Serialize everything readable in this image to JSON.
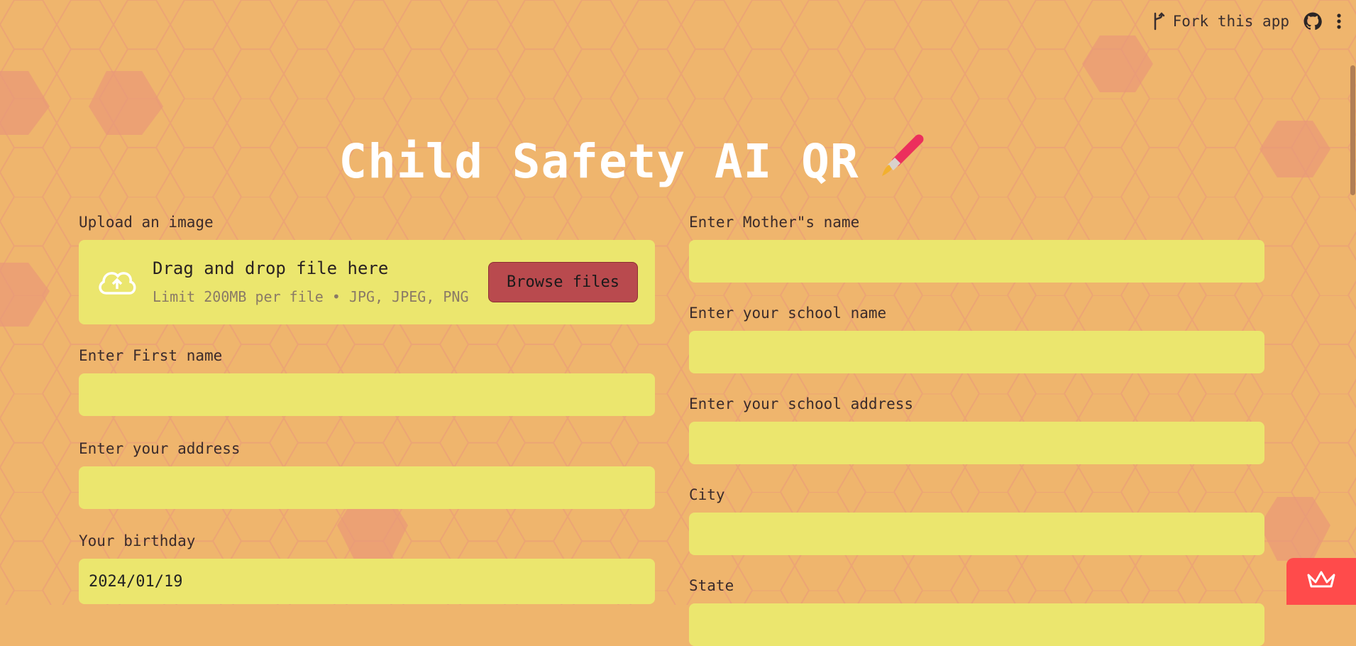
{
  "header": {
    "fork_label": "Fork this app",
    "fork_icon": "fork-icon",
    "github_icon": "github-icon",
    "menu_icon": "kebab-menu-icon"
  },
  "title": "Child Safety AI QR",
  "title_icon": "paintbrush-icon",
  "upload": {
    "label": "Upload an image",
    "drop_text": "Drag and drop file here",
    "limit_text": "Limit 200MB per file • JPG, JPEG, PNG",
    "button_label": "Browse files",
    "icon": "cloud-upload-icon"
  },
  "left_fields": {
    "first_name": {
      "label": "Enter First name",
      "value": ""
    },
    "address": {
      "label": "Enter your address",
      "value": ""
    },
    "birthday": {
      "label": "Your birthday",
      "value": "2024/01/19"
    }
  },
  "right_fields": {
    "mother_name": {
      "label": "Enter Mother\"s name",
      "value": ""
    },
    "school_name": {
      "label": "Enter your school name",
      "value": ""
    },
    "school_address": {
      "label": "Enter your school address",
      "value": ""
    },
    "city": {
      "label": "City",
      "value": ""
    },
    "state": {
      "label": "State",
      "value": ""
    }
  },
  "colors": {
    "background": "#efb56d",
    "input_bg": "#ebe66e",
    "button_bg": "#b94a4e",
    "badge_bg": "#ff4b4b",
    "title": "#ffffff"
  },
  "badge_icon": "streamlit-crown-icon"
}
